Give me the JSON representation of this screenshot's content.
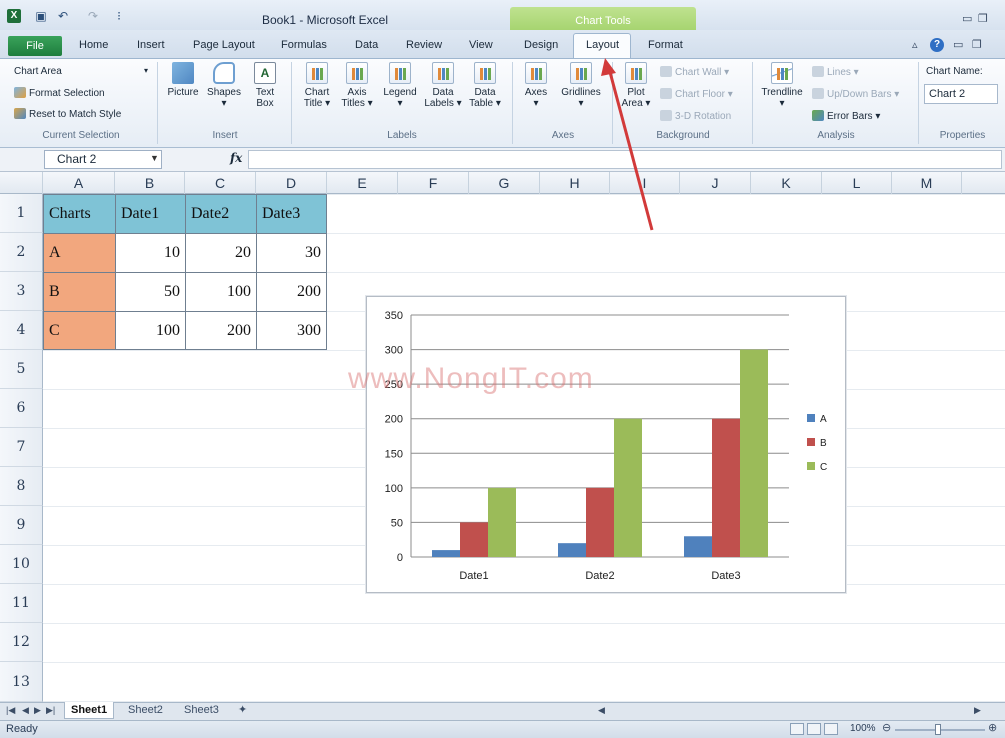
{
  "window": {
    "title": "Book1 - Microsoft Excel",
    "context_tab_group": "Chart Tools"
  },
  "colors": {
    "chart_tools_green": "#9fd067",
    "header_fill": "#7fc3d6",
    "category_fill": "#f2a77e",
    "series_a": "#4f81bd",
    "series_b": "#c0504d",
    "series_c": "#9bbb59",
    "annotation_arrow": "#d23a3a"
  },
  "tabs": {
    "file": "File",
    "home": "Home",
    "insert": "Insert",
    "page_layout": "Page Layout",
    "formulas": "Formulas",
    "data": "Data",
    "review": "Review",
    "view": "View",
    "design": "Design",
    "layout": "Layout",
    "format": "Format"
  },
  "ribbon": {
    "current_selection": {
      "dropdown": "Chart Area",
      "format_selection": "Format Selection",
      "reset": "Reset to Match Style",
      "label": "Current Selection"
    },
    "insert": {
      "picture": "Picture",
      "shapes": "Shapes",
      "text": "Text",
      "box": "Box",
      "label": "Insert"
    },
    "labels": {
      "chart": "Chart",
      "chart_sub": "Title",
      "axis": "Axis",
      "axis_sub": "Titles",
      "legend": "Legend",
      "data_labels": "Data",
      "data_labels_sub": "Labels",
      "data_table": "Data",
      "data_table_sub": "Table",
      "label": "Labels"
    },
    "axes": {
      "axes": "Axes",
      "gridlines": "Gridlines",
      "label": "Axes"
    },
    "background": {
      "plot": "Plot",
      "plot_sub": "Area",
      "chart_wall": "Chart Wall",
      "chart_floor": "Chart Floor",
      "rotation": "3-D Rotation",
      "label": "Background"
    },
    "analysis": {
      "trendline": "Trendline",
      "lines": "Lines",
      "updown": "Up/Down Bars",
      "error_bars": "Error Bars",
      "label": "Analysis"
    },
    "properties": {
      "chart_name_label": "Chart Name:",
      "chart_name_value": "Chart 2",
      "label": "Properties"
    }
  },
  "formula_bar": {
    "name_box": "Chart 2",
    "fx": "fx"
  },
  "columns": [
    "A",
    "B",
    "C",
    "D",
    "E",
    "F",
    "G",
    "H",
    "I",
    "J",
    "K",
    "L",
    "M"
  ],
  "rows": [
    "1",
    "2",
    "3",
    "4",
    "5",
    "6",
    "7",
    "8",
    "9",
    "10",
    "11",
    "12",
    "13"
  ],
  "table": {
    "header": [
      "Charts",
      "Date1",
      "Date2",
      "Date3"
    ],
    "body": [
      [
        "A",
        "10",
        "20",
        "30"
      ],
      [
        "B",
        "50",
        "100",
        "200"
      ],
      [
        "C",
        "100",
        "200",
        "300"
      ]
    ]
  },
  "watermark": "www.NongIT.com",
  "chart_data": {
    "type": "bar",
    "categories": [
      "Date1",
      "Date2",
      "Date3"
    ],
    "series": [
      {
        "name": "A",
        "values": [
          10,
          20,
          30
        ]
      },
      {
        "name": "B",
        "values": [
          50,
          100,
          200
        ]
      },
      {
        "name": "C",
        "values": [
          100,
          200,
          300
        ]
      }
    ],
    "ylim": [
      0,
      350
    ],
    "yticks": [
      0,
      50,
      100,
      150,
      200,
      250,
      300,
      350
    ],
    "grid": true,
    "legend": "right"
  },
  "sheets": [
    "Sheet1",
    "Sheet2",
    "Sheet3"
  ],
  "status": {
    "ready": "Ready",
    "zoom": "100%"
  }
}
